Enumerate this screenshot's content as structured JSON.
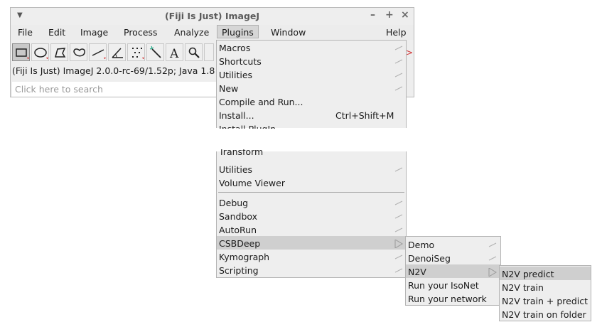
{
  "window": {
    "title": "(Fiji Is Just) ImageJ",
    "controls": [
      "–",
      "+",
      "×"
    ]
  },
  "menubar": [
    "File",
    "Edit",
    "Image",
    "Process",
    "Analyze",
    "Plugins",
    "Window",
    "Help"
  ],
  "status_text": "(Fiji Is Just) ImageJ 2.0.0-rc-69/1.52p; Java 1.8",
  "search": {
    "placeholder": "Click here to search"
  },
  "plugins_menu": {
    "top_items": [
      {
        "label": "Macros",
        "submenu": true
      },
      {
        "label": "Shortcuts",
        "submenu": true
      },
      {
        "label": "Utilities",
        "submenu": true
      },
      {
        "label": "New",
        "submenu": true
      },
      {
        "label": "Compile and Run..."
      },
      {
        "label": "Install...",
        "shortcut": "Ctrl+Shift+M"
      },
      {
        "label": "Install PlugIn..."
      }
    ],
    "bottom_items": [
      {
        "label": "Transform",
        "submenu": true
      },
      {
        "label": "Utilities",
        "submenu": true
      },
      {
        "label": "Volume Viewer"
      },
      {
        "label": "Debug",
        "submenu": true
      },
      {
        "label": "Sandbox",
        "submenu": true
      },
      {
        "label": "AutoRun",
        "submenu": true
      },
      {
        "label": "CSBDeep",
        "submenu": true,
        "highlighted": true
      },
      {
        "label": "Kymograph",
        "submenu": true
      },
      {
        "label": "Scripting",
        "submenu": true
      }
    ]
  },
  "csbdeep_menu": [
    {
      "label": "Demo",
      "submenu": true
    },
    {
      "label": "DenoiSeg",
      "submenu": true
    },
    {
      "label": "N2V",
      "submenu": true,
      "highlighted": true
    },
    {
      "label": "Run your IsoNet"
    },
    {
      "label": "Run your network"
    }
  ],
  "n2v_menu": [
    {
      "label": "N2V predict",
      "highlighted": true
    },
    {
      "label": "N2V train"
    },
    {
      "label": "N2V train + predict"
    },
    {
      "label": "N2V train on folder"
    }
  ],
  "tools": [
    "rectangle-tool-icon",
    "oval-tool-icon",
    "polygon-tool-icon",
    "freehand-tool-icon",
    "line-tool-icon",
    "angle-tool-icon",
    "multipoint-tool-icon",
    "wand-tool-icon",
    "text-tool-icon",
    "magnifier-tool-icon"
  ],
  "colors": {
    "menu_bg": "#eeeeee",
    "highlight": "#cfcfcf",
    "separator": "#a8a8a8"
  }
}
